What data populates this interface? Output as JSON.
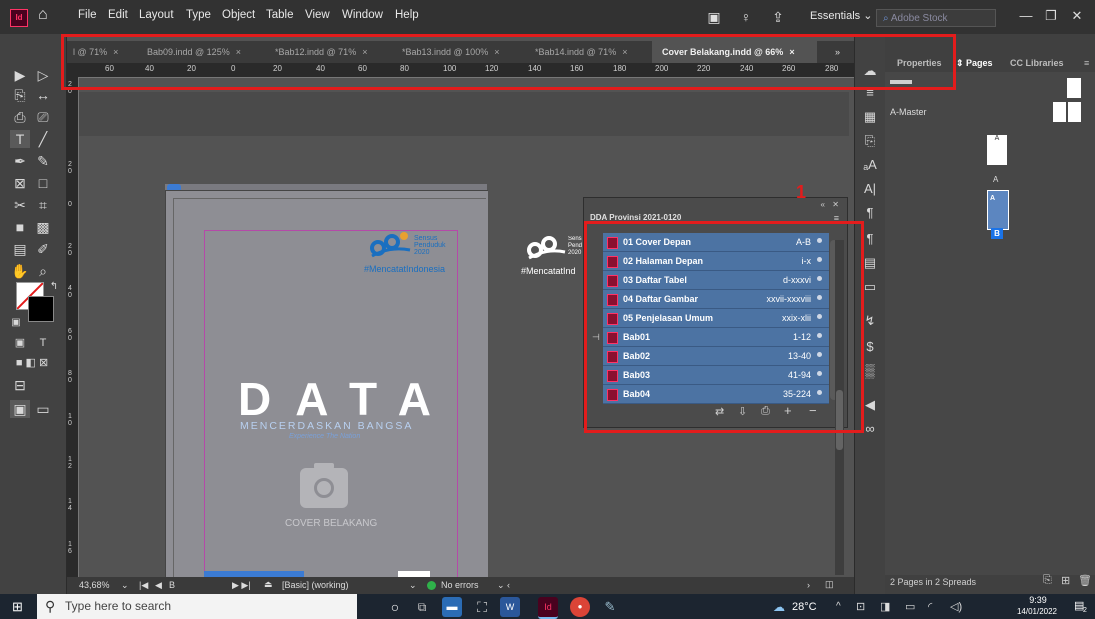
{
  "menubar": {
    "items": [
      "File",
      "Edit",
      "Layout",
      "Type",
      "Object",
      "Table",
      "View",
      "Window",
      "Help"
    ],
    "workspace": "Essentials",
    "stock_placeholder": "Adobe Stock",
    "app_badge": "Id"
  },
  "tabs": [
    {
      "label": "l @ 71%"
    },
    {
      "label": "Bab09.indd @ 125%"
    },
    {
      "label": "*Bab12.indd @ 71%"
    },
    {
      "label": "*Bab13.indd @ 100%"
    },
    {
      "label": "*Bab14.indd @ 71%"
    },
    {
      "label": "Cover Belakang.indd @ 66%",
      "active": true
    }
  ],
  "tab_close": "×",
  "tab_overflow": "»",
  "ruler": {
    "h_ticks": [
      "60",
      "40",
      "20",
      "0",
      "20",
      "40",
      "60",
      "80",
      "100",
      "120",
      "140",
      "160",
      "180",
      "200",
      "220",
      "240",
      "260",
      "280"
    ],
    "v_ticks": [
      "2",
      "0",
      "2",
      "0",
      "4",
      "0",
      "6",
      "0",
      "8",
      "0",
      "1",
      "0",
      "1",
      "2",
      "1",
      "4",
      "1",
      "6"
    ]
  },
  "document": {
    "census_line1": "Sensus",
    "census_line2": "Penduduk",
    "census_line3": "2020",
    "hashtag": "#MencatatIndonesia",
    "hashtag_outside": "#MencatatInd",
    "big_word": "DATA",
    "tagline": "MENCERDASKAN BANGSA",
    "subtagline": "Experience The Nation",
    "image_placeholder": "COVER BELAKANG"
  },
  "books_panel": {
    "title": "DDA Provinsi 2021-0120",
    "rows": [
      {
        "name": "01 Cover Depan",
        "pages": "A-B"
      },
      {
        "name": "02 Halaman Depan",
        "pages": "i-x"
      },
      {
        "name": "03 Daftar Tabel",
        "pages": "d-xxxvi"
      },
      {
        "name": "04 Daftar Gambar",
        "pages": "xxvii-xxxviii"
      },
      {
        "name": "05 Penjelasan Umum",
        "pages": "xxix-xlii"
      },
      {
        "name": "Bab01",
        "pages": "1-12"
      },
      {
        "name": "Bab02",
        "pages": "13-40"
      },
      {
        "name": "Bab03",
        "pages": "41-94"
      },
      {
        "name": "Bab04",
        "pages": "35-224"
      }
    ]
  },
  "annotation_number": "1",
  "right_panel": {
    "tabs": [
      "Properties",
      "Pages",
      "CC Libraries"
    ],
    "active_tab": "Pages",
    "master": "A-Master",
    "page_label_a": "A",
    "page_label_b": "B",
    "status": "2 Pages in 2 Spreads"
  },
  "status_bar": {
    "zoom": "43,68%",
    "page": "B",
    "style": "[Basic] (working)",
    "preflight": "No errors"
  },
  "taskbar": {
    "search_placeholder": "Type here to search",
    "temperature": "28°C",
    "time": "9:39",
    "date": "14/01/2022",
    "notif_count": "2"
  },
  "colors": {
    "highlight": "#e31c1c",
    "book_row": "#4c73a3",
    "indesign": "#ff3366",
    "census_blue": "#1a6fc0"
  }
}
